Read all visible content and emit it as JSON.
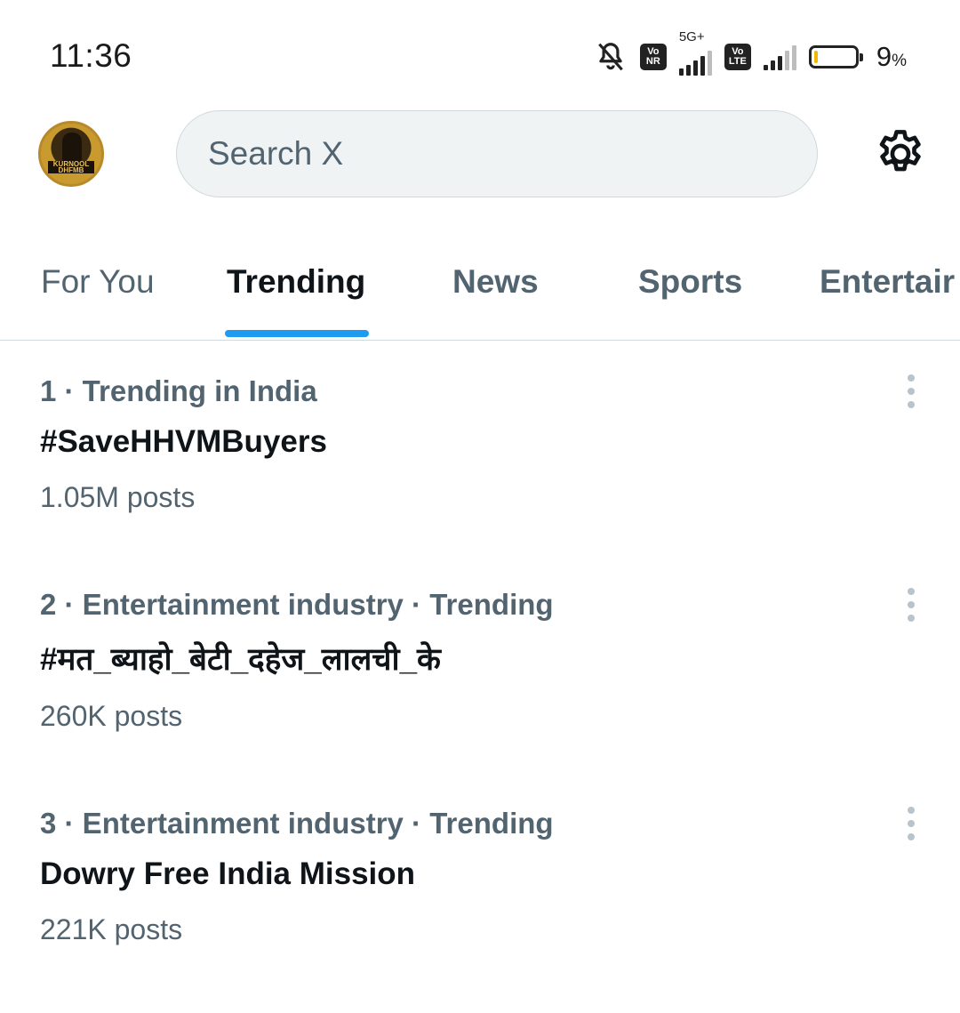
{
  "status_bar": {
    "time": "11:36",
    "net1_line1": "Vo",
    "net1_line2": "NR",
    "net1_tech": "5G+",
    "net2_line1": "Vo",
    "net2_line2": "LTE",
    "battery_percent": "9",
    "battery_percent_sign": "%",
    "battery_level": 0.09,
    "icons": [
      "bell-off-icon",
      "signal-icon",
      "battery-icon"
    ],
    "colors": {
      "battery_low": "#f2b705"
    }
  },
  "header": {
    "avatar_text": "KURNOOL DHFMB",
    "search_placeholder": "Search X",
    "settings_icon": "gear-icon"
  },
  "tabs": [
    {
      "label": "For You",
      "active": false
    },
    {
      "label": "Trending",
      "active": true
    },
    {
      "label": "News",
      "active": false
    },
    {
      "label": "Sports",
      "active": false
    },
    {
      "label": "Entertair",
      "active": false
    }
  ],
  "accent_color": "#1d9bf0",
  "trends": [
    {
      "meta": "1 · Trending in India",
      "topic": "#SaveHHVMBuyers",
      "posts": "1.05M posts"
    },
    {
      "meta": "2 · Entertainment industry · Trending",
      "topic": "#मत_ब्याहो_बेटी_दहेज_लालची_के",
      "posts": "260K posts"
    },
    {
      "meta": "3 · Entertainment industry · Trending",
      "topic": "Dowry Free India Mission",
      "posts": "221K posts"
    }
  ]
}
